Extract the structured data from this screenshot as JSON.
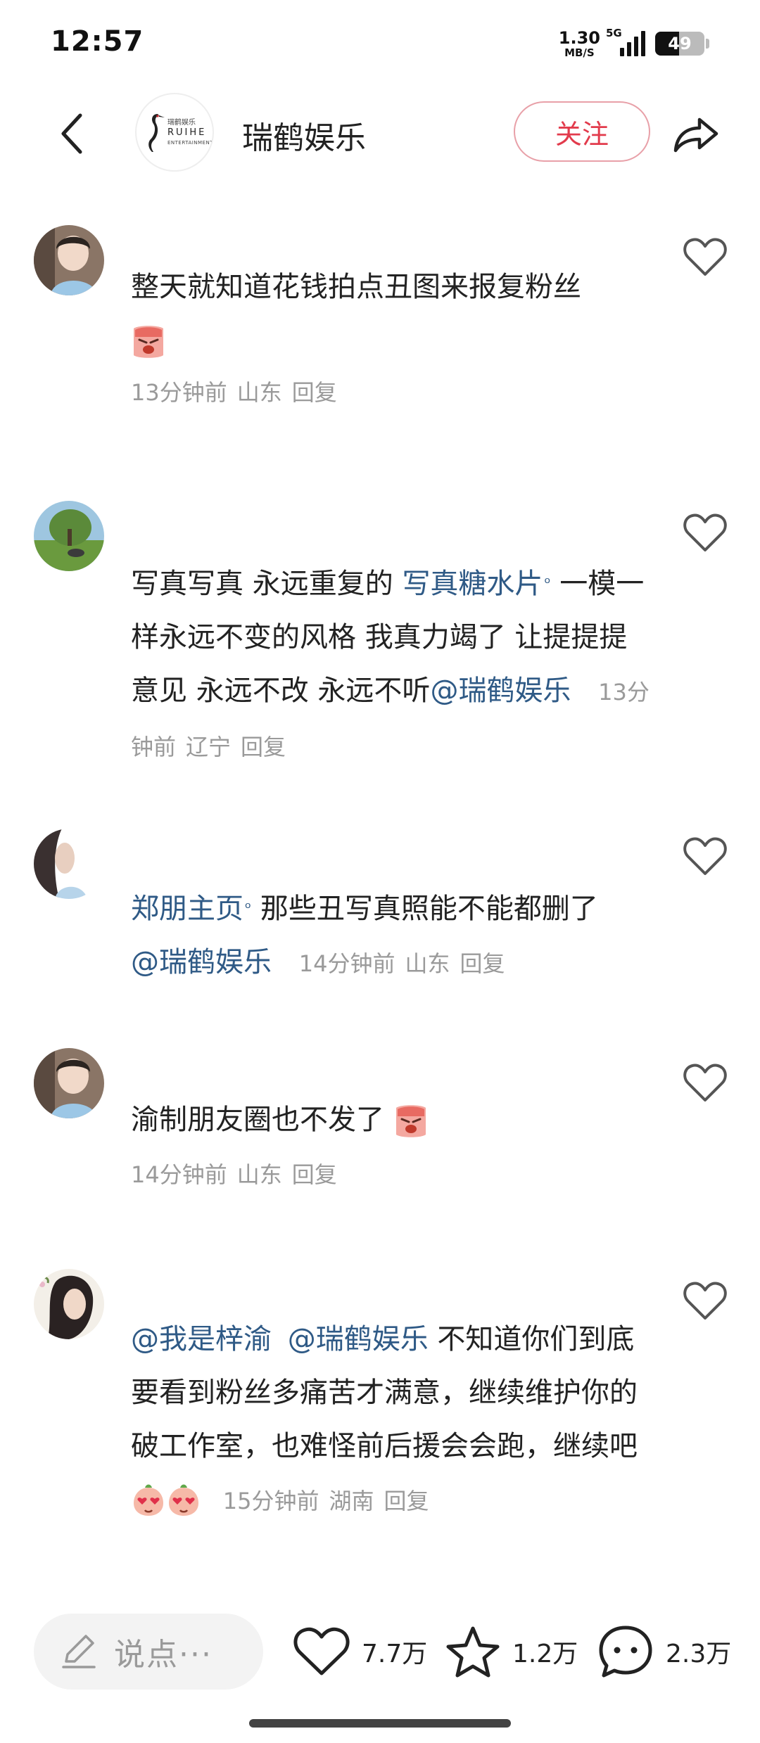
{
  "status_bar": {
    "time": "12:57",
    "net_speed_value": "1.30",
    "net_speed_unit": "MB/S",
    "network_type": "5G",
    "battery_level": "49",
    "battery_fraction": 0.49
  },
  "header": {
    "back_icon": "chevron-left-icon",
    "account_name": "瑞鹤娱乐",
    "logo_line1": "瑞鹤娱乐",
    "logo_line2": "RUIHE",
    "logo_line3": "ENTERTAINMENT",
    "follow_label": "关注",
    "share_icon": "share-arrow-icon"
  },
  "colors": {
    "accent_red": "#e23b4c",
    "link_blue": "#2f5a86",
    "meta_gray": "#9a9a9a"
  },
  "comments": [
    {
      "text": "整天就知道花钱拍点丑图来报复粉丝",
      "time": "13分钟前",
      "location": "山东",
      "reply": "回复"
    },
    {
      "text_a": "写真写真  永远重复的 ",
      "link1": "写真糖水片",
      "text_b": " 一模一样永远不变的风格 我真力竭了  让提提提意见 永远不改 永远不听",
      "mention": "@瑞鹤娱乐",
      "time": "13分钟前",
      "location": "辽宁",
      "reply": "回复"
    },
    {
      "link1": "郑朋主页",
      "text_a": " 那些丑写真照能不能都删了",
      "mention": "@瑞鹤娱乐",
      "time": "14分钟前",
      "location": "山东",
      "reply": "回复"
    },
    {
      "text": "渝制朋友圈也不发了",
      "time": "14分钟前",
      "location": "山东",
      "reply": "回复"
    },
    {
      "mention1": "@我是梓渝",
      "mention2": "@瑞鹤娱乐",
      "text_a": " 不知道你们到底要看到粉丝多痛苦才满意，继续维护你的破工作室，也难怪前后援会会跑，继续吧",
      "time": "15分钟前",
      "location": "湖南",
      "reply": "回复"
    }
  ],
  "bottom_bar": {
    "input_placeholder": "说点···",
    "like_count": "7.7万",
    "favorite_count": "1.2万",
    "comment_count": "2.3万"
  }
}
